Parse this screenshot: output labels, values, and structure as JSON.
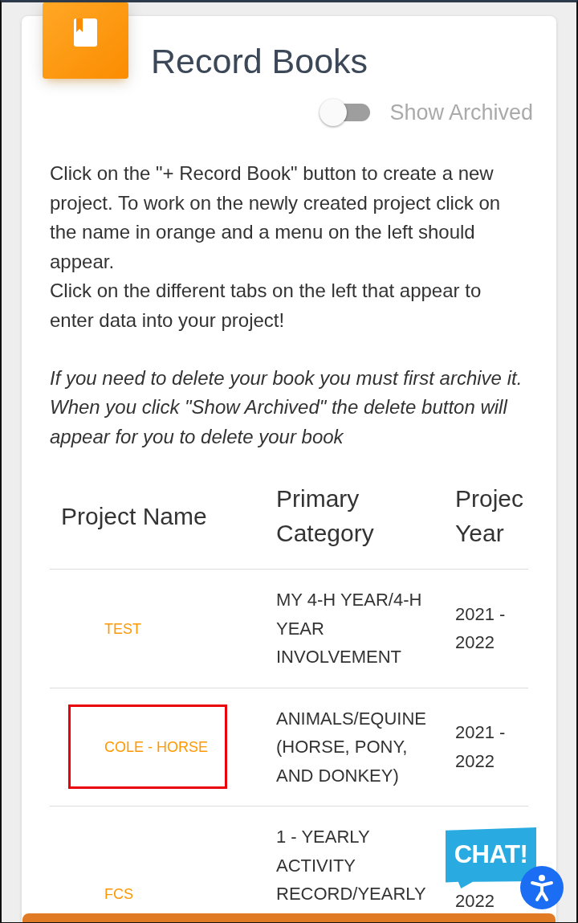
{
  "header": {
    "title": "Record Books"
  },
  "show_archived": {
    "label": "Show Archived",
    "on": false
  },
  "instructions": [
    "Click on the \"+ Record Book\" button to create a new project. To work on the newly created project click on the name in orange and a menu on the left should appear.",
    "Click on the different tabs on the left that appear to enter data into your project!"
  ],
  "note": "If you need to delete your book you must first archive it. When you click \"Show Archived\" the delete button will appear for you to delete your book",
  "table": {
    "columns": [
      "Project Name",
      "Primary Category",
      "Projec Year"
    ],
    "rows": [
      {
        "project_name": "TEST",
        "primary_category": "MY 4-H YEAR/4-H YEAR INVOLVEMENT",
        "project_year": "2021 - 2022",
        "highlighted": false
      },
      {
        "project_name": "COLE - HORSE",
        "primary_category": "ANIMALS/EQUINE (HORSE, PONY, AND DONKEY)",
        "project_year": "2021 - 2022",
        "highlighted": true
      },
      {
        "project_name": "FCS",
        "primary_category": "1 - YEARLY ACTIVITY RECORD/YEARLY",
        "project_year": "2022",
        "highlighted": false
      }
    ]
  },
  "chat": {
    "label": "CHAT!"
  }
}
